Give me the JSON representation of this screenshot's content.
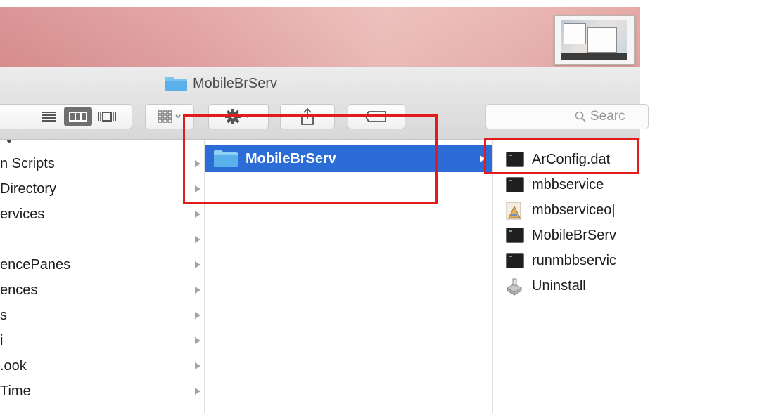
{
  "window": {
    "title": "MobileBrServ"
  },
  "toolbar": {
    "view_buttons": [
      "list-view",
      "column-view",
      "cover-flow-view"
    ],
    "active_view": "column-view",
    "search_placeholder": "Searc"
  },
  "column1": {
    "items": [
      {
        "label": "n Scripts"
      },
      {
        "label": "Directory"
      },
      {
        "label": "ervices"
      },
      {
        "label": ""
      },
      {
        "label": "encePanes"
      },
      {
        "label": "ences"
      },
      {
        "label": "s"
      },
      {
        "label": "i"
      },
      {
        "label": ".ook"
      },
      {
        "label": "Time"
      }
    ]
  },
  "column2": {
    "selected": {
      "label": "MobileBrServ",
      "icon": "folder-icon"
    }
  },
  "column3": {
    "items": [
      {
        "label": "ArConfig.dat",
        "icon": "terminal-file-icon"
      },
      {
        "label": "mbbservice",
        "icon": "terminal-file-icon"
      },
      {
        "label": "mbbserviceo|",
        "icon": "app-script-icon"
      },
      {
        "label": "MobileBrServ",
        "icon": "terminal-file-icon"
      },
      {
        "label": "runmbbservic",
        "icon": "terminal-file-icon"
      },
      {
        "label": "Uninstall",
        "icon": "uninstaller-icon"
      }
    ]
  },
  "colors": {
    "selection": "#2b6cd6",
    "highlight_box": "#e21b1b",
    "folder": "#5ab0ea"
  }
}
